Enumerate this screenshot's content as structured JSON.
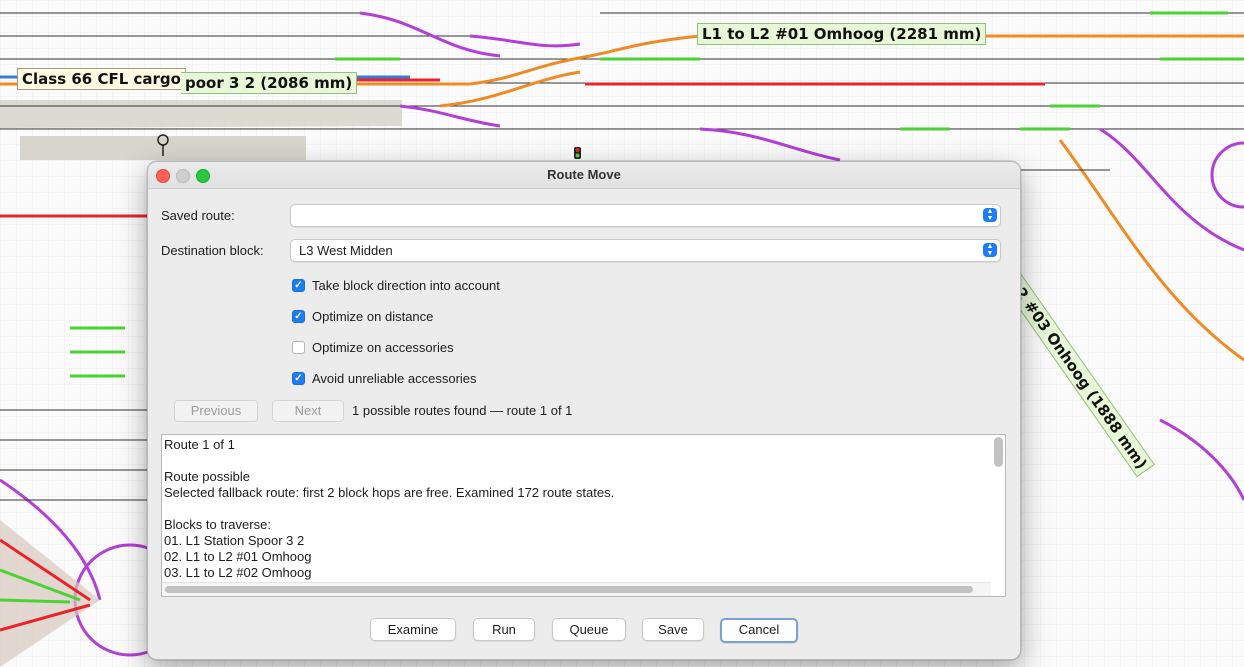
{
  "layout_labels": {
    "train": "Class 66 CFL cargo",
    "block_station": "poor 3 2 (2086 mm)",
    "block_01": "L1 to L2 #01 Omhoog (2281 mm)",
    "block_03": "L1 to L2 #03 Onhoog (1888 mm)"
  },
  "dialog": {
    "title": "Route Move",
    "saved_route_label": "Saved route:",
    "saved_route_value": "",
    "destination_label": "Destination block:",
    "destination_value": "L3 West Midden",
    "options": [
      {
        "label": "Take block direction into account",
        "checked": true
      },
      {
        "label": "Optimize on distance",
        "checked": true
      },
      {
        "label": "Optimize on accessories",
        "checked": false
      },
      {
        "label": "Avoid unreliable accessories",
        "checked": true
      }
    ],
    "previous_label": "Previous",
    "next_label": "Next",
    "routes_status": "1 possible routes found — route 1 of 1",
    "log_lines": [
      "Route 1 of 1",
      "",
      "Route possible",
      "Selected fallback route: first 2 block hops are free. Examined 172 route states.",
      "",
      "Blocks to traverse:",
      "01. L1 Station Spoor 3 2",
      "02. L1 to L2 #01 Omhoog",
      "03. L1 to L2 #02 Omhoog"
    ],
    "buttons": {
      "examine": "Examine",
      "run": "Run",
      "queue": "Queue",
      "save": "Save",
      "cancel": "Cancel"
    }
  },
  "colors": {
    "track_occupied": "#e8242a",
    "track_reserved": "#f08a24",
    "track_free": "#4cd235",
    "turnout": "#b23fd6",
    "accent": "#1e7cf5"
  }
}
